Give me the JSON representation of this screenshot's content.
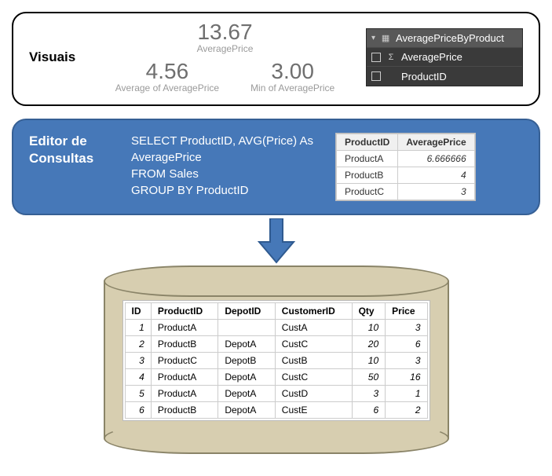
{
  "visuais": {
    "title": "Visuais",
    "metric1": {
      "value": "13.67",
      "label": "AveragePrice"
    },
    "metric2": {
      "value": "4.56",
      "label": "Average of AveragePrice"
    },
    "metric3": {
      "value": "3.00",
      "label": "Min of AveragePrice"
    },
    "fields": {
      "table": "AveragePriceByProduct",
      "col1": "AveragePrice",
      "col2": "ProductID",
      "sigma": "Σ"
    }
  },
  "editor": {
    "title": "Editor de Consultas",
    "sql_line1": "SELECT ProductID, AVG(Price) As AveragePrice",
    "sql_line2": "FROM Sales",
    "sql_line3": "GROUP BY ProductID",
    "result": {
      "headers": {
        "c1": "ProductID",
        "c2": "AveragePrice"
      },
      "rows": [
        {
          "pid": "ProductA",
          "avg": "6.666666"
        },
        {
          "pid": "ProductB",
          "avg": "4"
        },
        {
          "pid": "ProductC",
          "avg": "3"
        }
      ]
    }
  },
  "sales": {
    "headers": {
      "id": "ID",
      "pid": "ProductID",
      "did": "DepotID",
      "cid": "CustomerID",
      "qty": "Qty",
      "price": "Price"
    },
    "rows": [
      {
        "id": "1",
        "pid": "ProductA",
        "did": "",
        "cid": "CustA",
        "qty": "10",
        "price": "3"
      },
      {
        "id": "2",
        "pid": "ProductB",
        "did": "DepotA",
        "cid": "CustC",
        "qty": "20",
        "price": "6"
      },
      {
        "id": "3",
        "pid": "ProductC",
        "did": "DepotB",
        "cid": "CustB",
        "qty": "10",
        "price": "3"
      },
      {
        "id": "4",
        "pid": "ProductA",
        "did": "DepotA",
        "cid": "CustC",
        "qty": "50",
        "price": "16"
      },
      {
        "id": "5",
        "pid": "ProductA",
        "did": "DepotA",
        "cid": "CustD",
        "qty": "3",
        "price": "1"
      },
      {
        "id": "6",
        "pid": "ProductB",
        "did": "DepotA",
        "cid": "CustE",
        "qty": "6",
        "price": "2"
      }
    ]
  }
}
